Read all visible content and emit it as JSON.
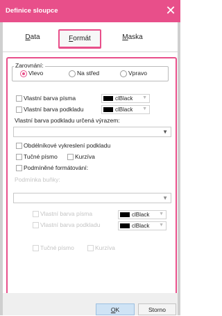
{
  "window": {
    "title": "Definice sloupce"
  },
  "tabs": [
    {
      "label": "Data",
      "accel": "D",
      "rest": "ata"
    },
    {
      "label": "Formát",
      "accel": "F",
      "rest": "ormát"
    },
    {
      "label": "Maska",
      "accel": "M",
      "rest": "aska"
    }
  ],
  "alignment": {
    "label": "Zarovnání:",
    "options": [
      "Vlevo",
      "Na střed",
      "Vpravo"
    ],
    "selected": "Vlevo"
  },
  "font_color": {
    "label": "Vlastní barva písma",
    "checked": false,
    "value": "clBlack"
  },
  "bg_color": {
    "label": "Vlastní barva podkladu",
    "checked": false,
    "value": "clBlack"
  },
  "bg_expr": {
    "label": "Vlastní barva podkladu určená výrazem:",
    "value": ""
  },
  "rect_bg": {
    "label": "Obdélníkové vykreslení podkladu",
    "checked": false
  },
  "bold": {
    "label": "Tučné písmo",
    "checked": false
  },
  "italic": {
    "label": "Kurzíva",
    "checked": false
  },
  "conditional": {
    "label": "Podmíněné formátování:",
    "checked": false
  },
  "cell_condition": {
    "label": "Podmínka buňky:",
    "value": ""
  },
  "cond_font_color": {
    "label": "Vlastní barva písma",
    "value": "clBlack"
  },
  "cond_bg_color": {
    "label": "Vlastní barva podkladu",
    "value": "clBlack"
  },
  "cond_bold": {
    "label": "Tučné písmo"
  },
  "cond_italic": {
    "label": "Kurzíva"
  },
  "buttons": {
    "ok": "OK",
    "ok_accel": "O",
    "ok_rest": "K",
    "cancel": "Storno"
  },
  "colors": {
    "accent": "#e84f8a",
    "ok_bg": "#cfe3f5",
    "swatch": "#000000"
  }
}
